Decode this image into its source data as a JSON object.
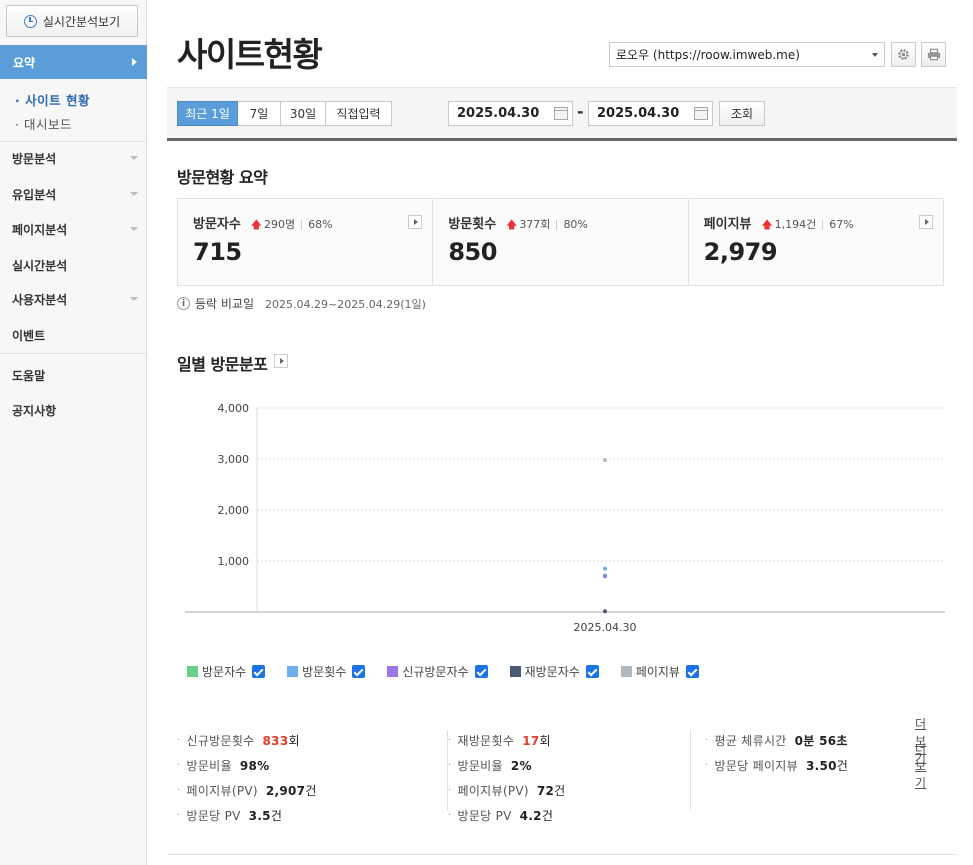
{
  "sidebar": {
    "realtime_button": "실시간분석보기",
    "active_menu": "요약",
    "sub_items": [
      "사이트 현황",
      "대시보드"
    ],
    "menu_items": [
      "방문분석",
      "유입분석",
      "페이지분석",
      "실시간분석",
      "사용자분석",
      "이벤트",
      "도움말",
      "공지사항"
    ]
  },
  "header": {
    "title": "사이트현황",
    "site_select": "로오우 (https://roow.imweb.me)"
  },
  "filter": {
    "period_tabs": [
      "최근 1일",
      "7일",
      "30일",
      "직접입력"
    ],
    "start_date": "2025.04.30",
    "date_separator": "-",
    "end_date": "2025.04.30",
    "search_label": "조회"
  },
  "summary": {
    "title": "방문현황 요약",
    "cards": [
      {
        "label": "방문자수",
        "delta": "290명",
        "pct": "68%",
        "value": "715"
      },
      {
        "label": "방문횟수",
        "delta": "377회",
        "pct": "80%",
        "value": "850"
      },
      {
        "label": "페이지뷰",
        "delta": "1,194건",
        "pct": "67%",
        "value": "2,979"
      }
    ],
    "compare_label": "등락 비교일",
    "compare_range": "2025.04.29~2025.04.29(1일)"
  },
  "daily": {
    "title": "일별 방문분포"
  },
  "chart_data": {
    "type": "scatter",
    "categories": [
      "2025.04.30"
    ],
    "ylim": [
      0,
      4000
    ],
    "yticks": [
      "4,000",
      "3,000",
      "2,000",
      "1,000"
    ],
    "ytick_values": [
      4000,
      3000,
      2000,
      1000
    ],
    "grid": true,
    "series": [
      {
        "name": "방문자수",
        "color": "#6cd08a",
        "values": [
          715
        ]
      },
      {
        "name": "방문횟수",
        "color": "#6ab0ea",
        "values": [
          850
        ]
      },
      {
        "name": "신규방문자수",
        "color": "#9b74e6",
        "values": [
          700
        ]
      },
      {
        "name": "재방문자수",
        "color": "#4a5a70",
        "values": [
          15
        ]
      },
      {
        "name": "페이지뷰",
        "color": "#b0b8c0",
        "values": [
          2979
        ]
      }
    ]
  },
  "stats": {
    "col1": [
      {
        "label": "신규방문횟수",
        "value": "833",
        "unit": "회",
        "red": true
      },
      {
        "label": "방문비율",
        "value": "98%",
        "unit": ""
      },
      {
        "label": "페이지뷰(PV)",
        "value": "2,907",
        "unit": "건"
      },
      {
        "label": "방문당 PV",
        "value": "3.5",
        "unit": "건"
      }
    ],
    "col2": [
      {
        "label": "재방문횟수",
        "value": "17",
        "unit": "회",
        "red": true
      },
      {
        "label": "방문비율",
        "value": "2%",
        "unit": ""
      },
      {
        "label": "페이지뷰(PV)",
        "value": "72",
        "unit": "건"
      },
      {
        "label": "방문당 PV",
        "value": "4.2",
        "unit": "건"
      }
    ],
    "col3": [
      {
        "label": "평균 체류시간",
        "value": "0분 56초",
        "unit": "",
        "more": "더보기"
      },
      {
        "label": "방문당 페이지뷰",
        "value": "3.50",
        "unit": "건",
        "more": "더보기"
      }
    ]
  }
}
